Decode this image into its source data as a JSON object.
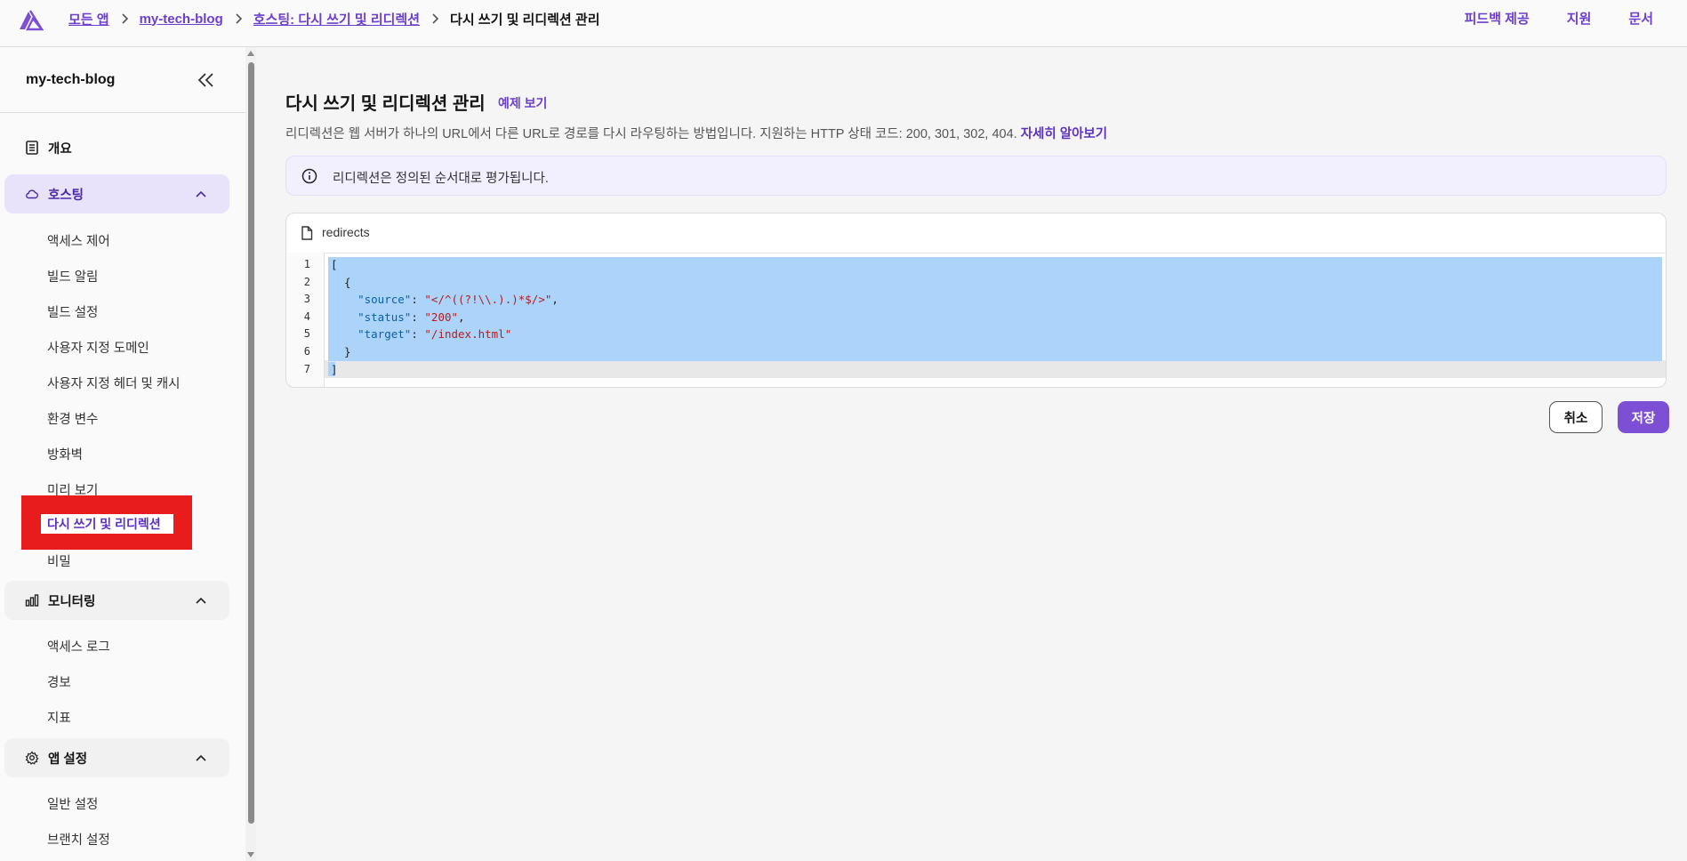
{
  "breadcrumb": {
    "items": [
      "모든 앱",
      "my-tech-blog",
      "호스팅: 다시 쓰기 및 리디렉션"
    ],
    "current": "다시 쓰기 및 리디렉션 관리"
  },
  "topnav": {
    "feedback": "피드백 제공",
    "support": "지원",
    "docs": "문서"
  },
  "sidebar": {
    "app_name": "my-tech-blog",
    "overview": "개요",
    "hosting": {
      "label": "호스팅",
      "items": [
        "액세스 제어",
        "빌드 알림",
        "빌드 설정",
        "사용자 지정 도메인",
        "사용자 지정 헤더 및 캐시",
        "환경 변수",
        "방화벽",
        "미리 보기",
        "다시 쓰기 및 리디렉션",
        "비밀"
      ]
    },
    "monitoring": {
      "label": "모니터링",
      "items": [
        "액세스 로그",
        "경보",
        "지표"
      ]
    },
    "app_settings": {
      "label": "앱 설정",
      "items": [
        "일반 설정",
        "브랜치 설정"
      ]
    }
  },
  "main": {
    "title": "다시 쓰기 및 리디렉션 관리",
    "example_link": "예제 보기",
    "description": "리디렉션은 웹 서버가 하나의 URL에서 다른 URL로 경로를 다시 라우팅하는 방법입니다. 지원하는 HTTP 상태 코드: 200, 301, 302, 404.",
    "learn_more": "자세히 알아보기",
    "alert": "리디렉션은 정의된 순서대로 평가됩니다.",
    "editor": {
      "filename": "redirects",
      "line_numbers": [
        "1",
        "2",
        "3",
        "4",
        "5",
        "6",
        "7"
      ],
      "lines": [
        "[",
        "  {",
        "    \"source\": \"</^((?!\\\\.).)*$/>\",",
        "    \"status\": \"200\",",
        "    \"target\": \"/index.html\"",
        "  }",
        "]"
      ]
    },
    "cancel_label": "취소",
    "save_label": "저장"
  },
  "colors": {
    "accent": "#7c4fd4",
    "highlight": "#e81c1c",
    "selection": "#acd4fb"
  },
  "icons": [
    "amplify-logo-icon",
    "chevron-right-icon",
    "double-chevron-left-icon",
    "document-list-icon",
    "cloud-icon",
    "chevron-up-icon",
    "bar-chart-icon",
    "gear-icon",
    "info-icon",
    "file-icon"
  ]
}
